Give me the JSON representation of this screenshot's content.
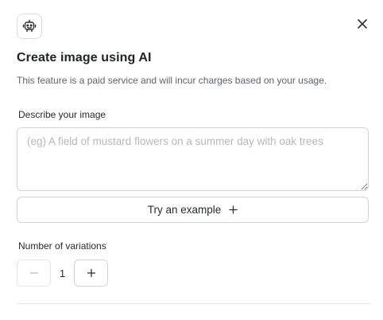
{
  "dialog": {
    "title": "Create image using AI",
    "subtitle": "This feature is a paid service and will incur charges based on your usage.",
    "badge_icon": "robot-icon",
    "close_icon": "close-icon"
  },
  "prompt": {
    "label": "Describe your image",
    "value": "",
    "placeholder": "(eg) A field of mustard flowers on a summer day with oak trees"
  },
  "try_example": {
    "label": "Try an example",
    "icon": "plus-icon"
  },
  "variations": {
    "label": "Number of variations",
    "value": "1",
    "decrement_icon": "minus-icon",
    "increment_icon": "plus-icon"
  },
  "colors": {
    "text": "#1f2328",
    "muted_text": "#5b6472",
    "placeholder": "#b3b8c0",
    "border": "#cfd3d9"
  }
}
